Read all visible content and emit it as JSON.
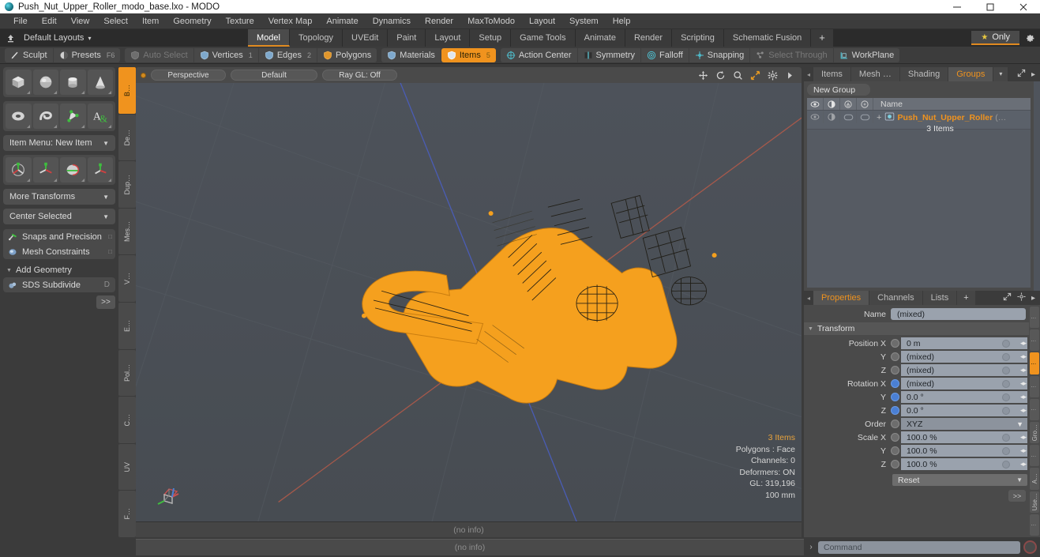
{
  "window": {
    "title": "Push_Nut_Upper_Roller_modo_base.lxo - MODO",
    "app_icon": "modo-orb-icon",
    "minimize": "—",
    "maximize": "☐",
    "close": "✕"
  },
  "menu": {
    "items": [
      "File",
      "Edit",
      "View",
      "Select",
      "Item",
      "Geometry",
      "Texture",
      "Vertex Map",
      "Animate",
      "Dynamics",
      "Render",
      "MaxToModo",
      "Layout",
      "System",
      "Help"
    ]
  },
  "layoutbar": {
    "home_icon": "home-layout-icon",
    "label": "Default Layouts",
    "caret": "▾",
    "tabs": [
      {
        "label": "Model",
        "selected": true
      },
      {
        "label": "Topology",
        "selected": false
      },
      {
        "label": "UVEdit",
        "selected": false
      },
      {
        "label": "Paint",
        "selected": false
      },
      {
        "label": "Layout",
        "selected": false
      },
      {
        "label": "Setup",
        "selected": false
      },
      {
        "label": "Game Tools",
        "selected": false
      },
      {
        "label": "Animate",
        "selected": false
      },
      {
        "label": "Render",
        "selected": false
      },
      {
        "label": "Scripting",
        "selected": false
      },
      {
        "label": "Schematic Fusion",
        "selected": false
      }
    ],
    "add_tab": "+",
    "only_label": "Only",
    "star_icon": "star-icon",
    "gear_icon": "gear-icon"
  },
  "modebar": {
    "group1": [
      {
        "label": "Sculpt",
        "icon": "sculpt-brush-icon",
        "state": "normal",
        "num": ""
      },
      {
        "label": "Presets",
        "icon": "presets-sphere-icon",
        "state": "normal",
        "num": "F6"
      }
    ],
    "group2": [
      {
        "label": "Auto Select",
        "icon": "shield-grey-icon",
        "state": "dim",
        "num": ""
      },
      {
        "label": "Vertices",
        "icon": "shield-blue-icon",
        "state": "normal",
        "num": "1"
      },
      {
        "label": "Edges",
        "icon": "shield-blue-icon",
        "state": "normal",
        "num": "2"
      },
      {
        "label": "Polygons",
        "icon": "shield-orange-icon",
        "state": "normal",
        "num": ""
      }
    ],
    "group3": [
      {
        "label": "Materials",
        "icon": "shield-blue-icon",
        "state": "normal",
        "num": ""
      },
      {
        "label": "Items",
        "icon": "shield-white-icon",
        "state": "on",
        "num": "5"
      }
    ],
    "group4": [
      {
        "label": "Action Center",
        "icon": "crosshair-target-icon",
        "state": "normal",
        "num": ""
      },
      {
        "label": "Symmetry",
        "icon": "symmetry-icon",
        "state": "normal",
        "num": ""
      },
      {
        "label": "Falloff",
        "icon": "falloff-circle-icon",
        "state": "normal",
        "num": ""
      },
      {
        "label": "Snapping",
        "icon": "snapping-cross-icon",
        "state": "normal",
        "num": ""
      },
      {
        "label": "Select Through",
        "icon": "select-through-icon",
        "state": "dim",
        "num": ""
      },
      {
        "label": "WorkPlane",
        "icon": "workplane-icon",
        "state": "normal",
        "num": ""
      }
    ]
  },
  "left_panel": {
    "primitive_rows": [
      [
        {
          "name": "cube-tool",
          "icon": "cube-icon"
        },
        {
          "name": "sphere-tool",
          "icon": "sphere-icon"
        },
        {
          "name": "cylinder-tool",
          "icon": "cylinder-icon"
        },
        {
          "name": "cone-tool",
          "icon": "cone-icon"
        }
      ],
      [
        {
          "name": "torus-tool",
          "icon": "torus-icon"
        },
        {
          "name": "spiral-tool",
          "icon": "spiral-icon"
        },
        {
          "name": "pen-tool",
          "icon": "pen-polygon-icon"
        },
        {
          "name": "text-tool",
          "icon": "text-A-icon"
        }
      ]
    ],
    "item_menu": "Item Menu: New Item",
    "transform_tools": [
      {
        "name": "move-tool",
        "icon": "move-axis-icon"
      },
      {
        "name": "rotate-tool",
        "icon": "rotate-axis-icon"
      },
      {
        "name": "scale-tool",
        "icon": "scale-axis-icon"
      },
      {
        "name": "transform-tool",
        "icon": "transform-axis-icon"
      }
    ],
    "more_transforms": "More Transforms",
    "center_selected": "Center Selected",
    "snaps_and_precision": "Snaps and Precision",
    "snaps_icon": "magnet-snap-icon",
    "mesh_constraints": "Mesh Constraints",
    "mesh_constraints_icon": "mesh-constraint-icon",
    "add_geometry": "Add Geometry",
    "sds_subdivide": "SDS Subdivide",
    "sds_icon": "sds-subdivide-icon",
    "sds_key": "D",
    "more_button": ">>",
    "vtabs": [
      {
        "label": "B…",
        "selected": true
      },
      {
        "label": "De…",
        "selected": false
      },
      {
        "label": "Dup…",
        "selected": false
      },
      {
        "label": "Mes…",
        "selected": false
      },
      {
        "label": "V…",
        "selected": false
      },
      {
        "label": "E…",
        "selected": false
      },
      {
        "label": "Pol…",
        "selected": false
      },
      {
        "label": "C…",
        "selected": false
      },
      {
        "label": "UV",
        "selected": false
      },
      {
        "label": "F…",
        "selected": false
      }
    ]
  },
  "viewport": {
    "active_dot": "viewport-active-dot",
    "view_mode": "Perspective",
    "shading": "Default",
    "raygl": "Ray GL: Off",
    "icons": [
      "pan-icon",
      "rotate-icon",
      "zoom-icon",
      "fit-icon",
      "gear-icon",
      "play-icon"
    ],
    "info": {
      "items": "3 Items",
      "polygons": "Polygons : Face",
      "channels": "Channels: 0",
      "deformers": "Deformers: ON",
      "gl": "GL: 319,196",
      "scale": "100 mm"
    },
    "gizmo": "axis-gizmo",
    "status": "(no info)",
    "bg_color": "#4a4f55",
    "model_color": "#f5a01e"
  },
  "groups_panel": {
    "tabs": [
      {
        "label": "Items",
        "selected": false
      },
      {
        "label": "Mesh …",
        "selected": false
      },
      {
        "label": "Shading",
        "selected": false
      },
      {
        "label": "Groups",
        "selected": true
      }
    ],
    "caret": "▾",
    "expand_icon": "expand-icon",
    "arrow_icon": "▸",
    "new_group_button": "New Group",
    "column_icons": [
      "eye-icon",
      "shade-icon",
      "lock-icon",
      "render-icon"
    ],
    "name_header": "Name",
    "rows": [
      {
        "expand": "+",
        "item_icon": "group-item-icon",
        "name": "Push_Nut_Upper_Roller",
        "tail": "(…",
        "sub": "3 Items"
      }
    ]
  },
  "properties_panel": {
    "tabs": [
      {
        "label": "Properties",
        "selected": true
      },
      {
        "label": "Channels",
        "selected": false
      },
      {
        "label": "Lists",
        "selected": false
      },
      {
        "label": "+",
        "selected": false
      }
    ],
    "expand_icon": "expand-icon",
    "gear_icon": "gear-icon",
    "arrow_icon": "▸",
    "name_label": "Name",
    "name_value": "(mixed)",
    "transform_label": "Transform",
    "fields": [
      {
        "label": "Position X",
        "value": "0 m",
        "bulb": "grey"
      },
      {
        "label": "Y",
        "value": "(mixed)",
        "bulb": "grey"
      },
      {
        "label": "Z",
        "value": "(mixed)",
        "bulb": "grey"
      },
      {
        "label": "Rotation X",
        "value": "(mixed)",
        "bulb": "blue"
      },
      {
        "label": "Y",
        "value": "0.0 °",
        "bulb": "blue"
      },
      {
        "label": "Z",
        "value": "0.0 °",
        "bulb": "blue"
      }
    ],
    "order_label": "Order",
    "order_value": "XYZ",
    "scale_fields": [
      {
        "label": "Scale X",
        "value": "100.0 %",
        "bulb": "grey"
      },
      {
        "label": "Y",
        "value": "100.0 %",
        "bulb": "grey"
      },
      {
        "label": "Z",
        "value": "100.0 %",
        "bulb": "grey"
      }
    ],
    "reset_label": "Reset",
    "more_button": ">>",
    "vtabs": [
      {
        "label": "",
        "selected": false
      },
      {
        "label": "",
        "selected": false
      },
      {
        "label": "",
        "selected": true
      },
      {
        "label": "",
        "selected": false
      },
      {
        "label": "",
        "selected": false
      },
      {
        "label": "Gro…",
        "selected": false
      },
      {
        "label": "",
        "selected": false
      },
      {
        "label": "A…",
        "selected": false
      },
      {
        "label": "Use…",
        "selected": false
      },
      {
        "label": "",
        "selected": false
      }
    ]
  },
  "bottom_bar": {
    "info": "(no info)",
    "command_arrow": "›",
    "command_placeholder": "Command",
    "record_icon": "record-icon"
  }
}
